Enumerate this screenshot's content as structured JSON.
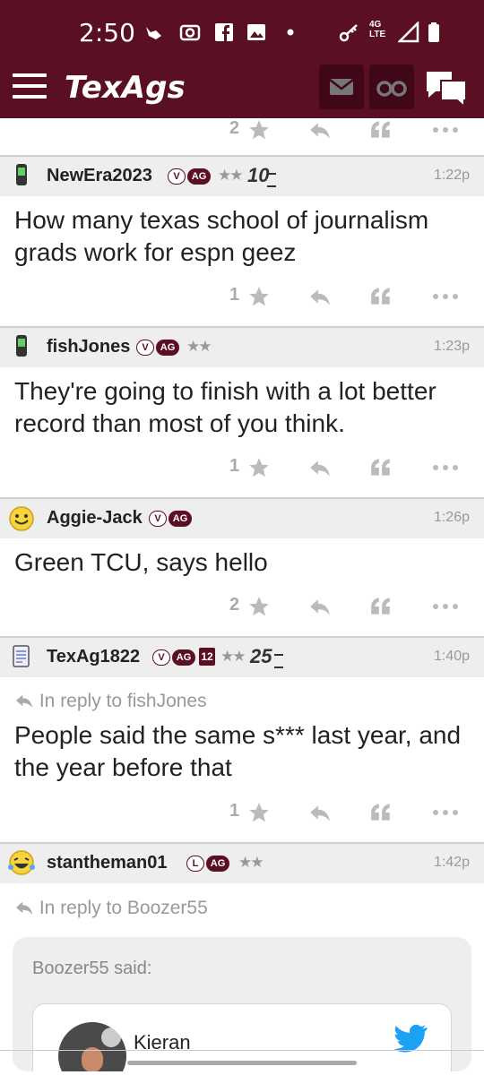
{
  "status_bar": {
    "time": "2:50",
    "network": "4G LTE"
  },
  "app": {
    "title": "TexAgs"
  },
  "prev_post": {
    "stars": "2"
  },
  "posts": [
    {
      "username": "NewEra2023",
      "badge_v": "V",
      "badge_ag": "AG",
      "stars": "★★",
      "rank": "10",
      "time": "1:22p",
      "text": "How many texas school of journalism grads work for espn geez",
      "star_count": "1"
    },
    {
      "username": "fishJones",
      "badge_v": "V",
      "badge_ag": "AG",
      "stars": "★★",
      "time": "1:23p",
      "text": "They're going to finish with a lot better record than most of you think.",
      "star_count": "1"
    },
    {
      "username": "Aggie-Jack",
      "badge_v": "V",
      "badge_ag": "AG",
      "time": "1:26p",
      "text": "Green TCU, says hello",
      "star_count": "2"
    },
    {
      "username": "TexAg1822",
      "badge_v": "V",
      "badge_ag": "AG",
      "badge_year": "12",
      "stars": "★★",
      "rank": "25",
      "time": "1:40p",
      "reply_to": "In reply to fishJones",
      "text": "People said the same s*** last year, and the year before that",
      "star_count": "1"
    },
    {
      "username": "stantheman01",
      "badge_v": "L",
      "badge_ag": "AG",
      "stars": "★★",
      "time": "1:42p",
      "reply_to": "In reply to Boozer55",
      "quote_said": "Boozer55 said:",
      "tweet_author": "Kieran"
    }
  ]
}
